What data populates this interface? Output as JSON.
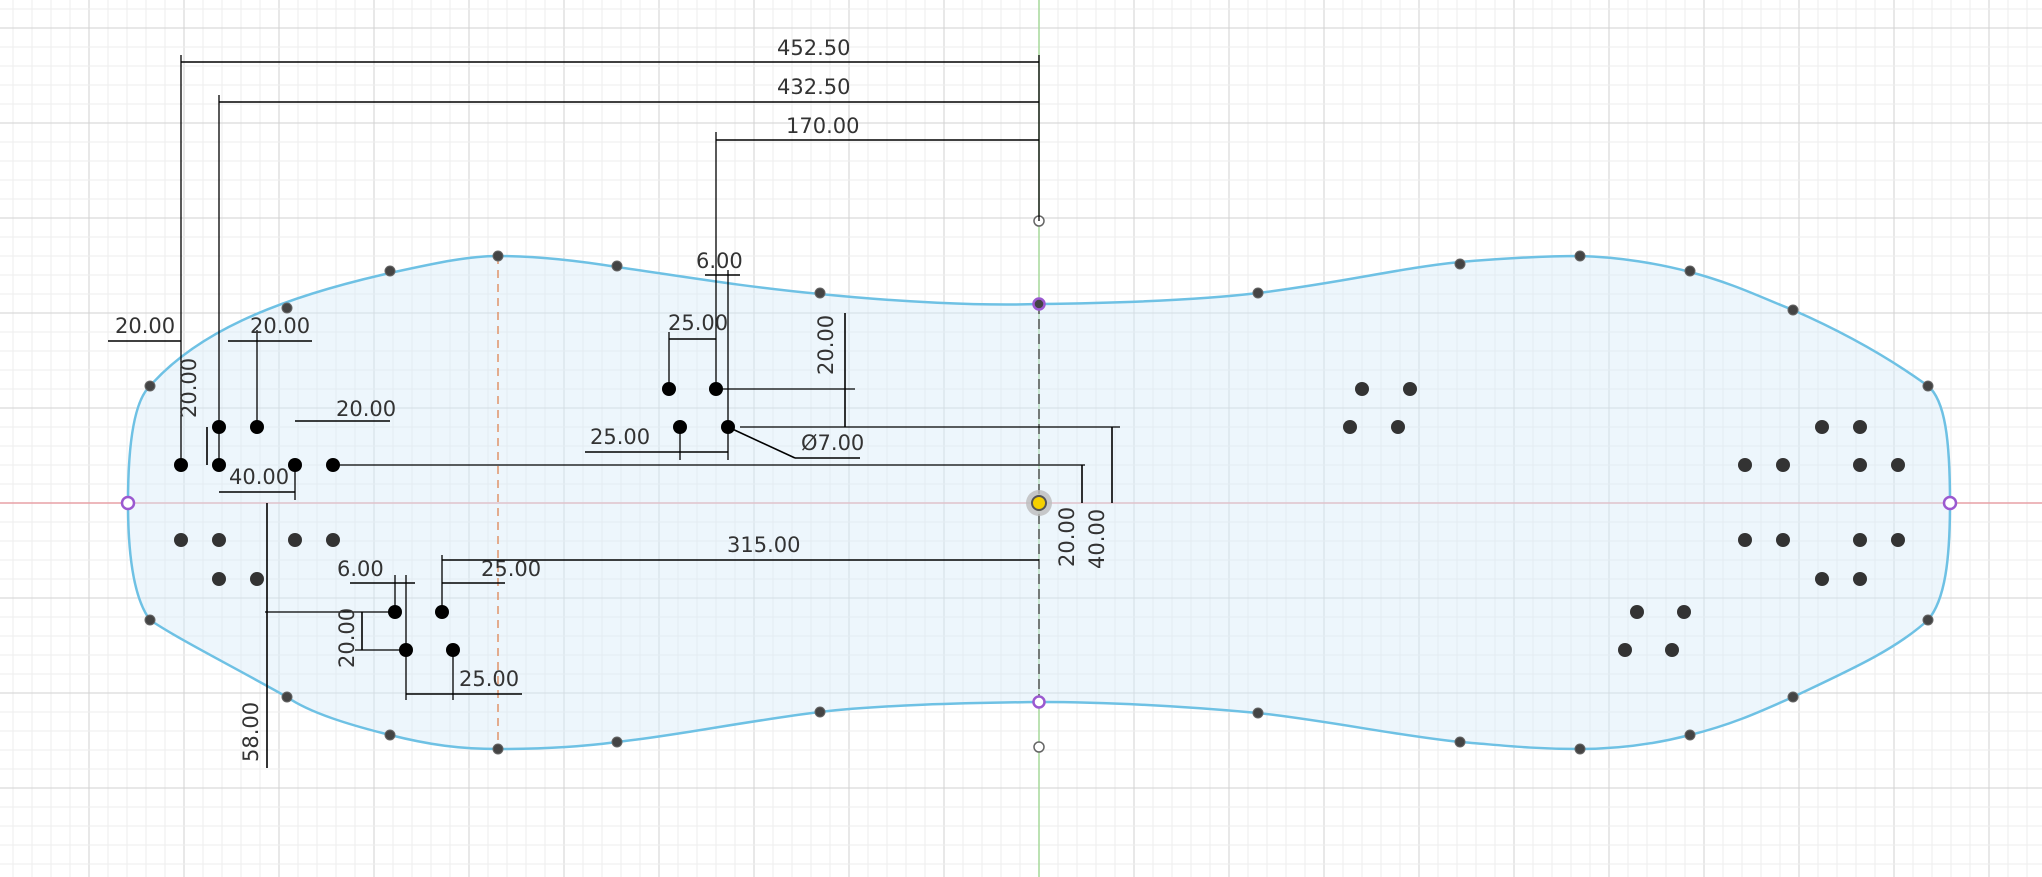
{
  "colors": {
    "background": "#ffffff",
    "grid_minor": "#ededed",
    "grid_major": "#d2d2d2",
    "profile_stroke": "#6ec1e4",
    "profile_fill": "#e8f3fb",
    "x_axis": "#e7a0a6",
    "y_axis": "#a6d99a",
    "construction": "#e0946a",
    "dimension": "#000000",
    "point_ring": "#9b59d0"
  },
  "dimensions": {
    "d1": "452.50",
    "d2": "432.50",
    "d3": "170.00",
    "d4": "6.00",
    "d5": "25.00",
    "d6": "20.00",
    "d7": "20.00",
    "d8": "20.00",
    "d9": "20.00",
    "d10": "20.00",
    "d11": "40.00",
    "d12": "25.00",
    "d13": "Ø7.00",
    "d14": "315.00",
    "d15": "20.00",
    "d16": "40.00",
    "d17": "6.00",
    "d18": "25.00",
    "d19": "20.00",
    "d20": "25.00",
    "d21": "58.00"
  }
}
